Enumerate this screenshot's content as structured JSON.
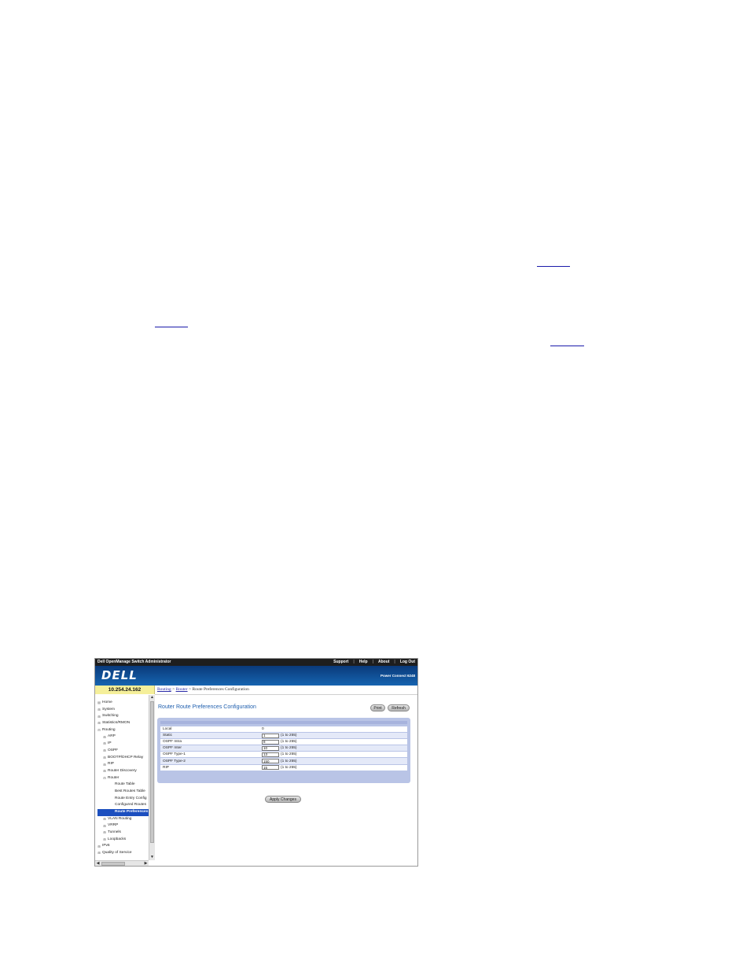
{
  "app": {
    "title": "Dell OpenManage Switch Administrator",
    "links": [
      "Support",
      "Help",
      "About",
      "Log Out"
    ],
    "logo": "DELL",
    "model": "Power Connect 6248"
  },
  "ip_address": "10.254.24.162",
  "breadcrumb": {
    "items": [
      "Routing",
      "Router"
    ],
    "separator": ">",
    "current": "Route Preferences Configuration"
  },
  "sidebar": {
    "items": [
      {
        "label": "Home",
        "level": 0,
        "expander": "",
        "selected": false
      },
      {
        "label": "System",
        "level": 0,
        "expander": "+",
        "selected": false
      },
      {
        "label": "Switching",
        "level": 0,
        "expander": "+",
        "selected": false
      },
      {
        "label": "Statistics/RMON",
        "level": 0,
        "expander": "+",
        "selected": false
      },
      {
        "label": "Routing",
        "level": 0,
        "expander": "-",
        "selected": false
      },
      {
        "label": "ARP",
        "level": 1,
        "expander": "+",
        "selected": false
      },
      {
        "label": "IP",
        "level": 1,
        "expander": "+",
        "selected": false
      },
      {
        "label": "OSPF",
        "level": 1,
        "expander": "+",
        "selected": false
      },
      {
        "label": "BOOTP/DHCP Relay",
        "level": 1,
        "expander": "+",
        "selected": false
      },
      {
        "label": "RIP",
        "level": 1,
        "expander": "+",
        "selected": false
      },
      {
        "label": "Router Discovery",
        "level": 1,
        "expander": "+",
        "selected": false
      },
      {
        "label": "Router",
        "level": 1,
        "expander": "-",
        "selected": false
      },
      {
        "label": "Route Table",
        "level": 2,
        "expander": "",
        "selected": false
      },
      {
        "label": "Best Routes Table",
        "level": 2,
        "expander": "",
        "selected": false
      },
      {
        "label": "Route Entry Config",
        "level": 2,
        "expander": "",
        "selected": false
      },
      {
        "label": "Configured Routes",
        "level": 2,
        "expander": "",
        "selected": false
      },
      {
        "label": "Route Preferences",
        "level": 2,
        "expander": "",
        "selected": true
      },
      {
        "label": "VLAN Routing",
        "level": 1,
        "expander": "+",
        "selected": false
      },
      {
        "label": "VRRP",
        "level": 1,
        "expander": "+",
        "selected": false
      },
      {
        "label": "Tunnels",
        "level": 1,
        "expander": "+",
        "selected": false
      },
      {
        "label": "Loopbacks",
        "level": 1,
        "expander": "+",
        "selected": false
      },
      {
        "label": "IPv6",
        "level": 0,
        "expander": "+",
        "selected": false
      },
      {
        "label": "Quality of Service",
        "level": 0,
        "expander": "+",
        "selected": false
      }
    ]
  },
  "main": {
    "title": "Router Route Preferences Configuration",
    "print_label": "Print",
    "refresh_label": "Refresh",
    "apply_label": "Apply Changes",
    "rows": [
      {
        "label": "Local",
        "value": "0",
        "editable": false,
        "range": ""
      },
      {
        "label": "Static",
        "value": "1",
        "editable": true,
        "range": "(1 to 255)"
      },
      {
        "label": "OSPF Intra",
        "value": "8",
        "editable": true,
        "range": "(1 to 255)"
      },
      {
        "label": "OSPF Inter",
        "value": "10",
        "editable": true,
        "range": "(1 to 255)"
      },
      {
        "label": "OSPF Type-1",
        "value": "13",
        "editable": true,
        "range": "(1 to 255)"
      },
      {
        "label": "OSPF Type-2",
        "value": "150",
        "editable": true,
        "range": "(1 to 255)"
      },
      {
        "label": "RIP",
        "value": "15",
        "editable": true,
        "range": "(1 to 255)"
      }
    ]
  },
  "colors": {
    "brand_gradient_top": "#0a3a7a",
    "brand_gradient_bottom": "#1664b0",
    "ip_bar": "#f5ef9a",
    "title_blue": "#1f5fae",
    "panel": "#b9c4e6",
    "selected_nav": "#1c4fbf"
  },
  "icons": {
    "expand": "plus-box-icon",
    "collapse": "minus-box-icon",
    "home": "home-icon"
  }
}
